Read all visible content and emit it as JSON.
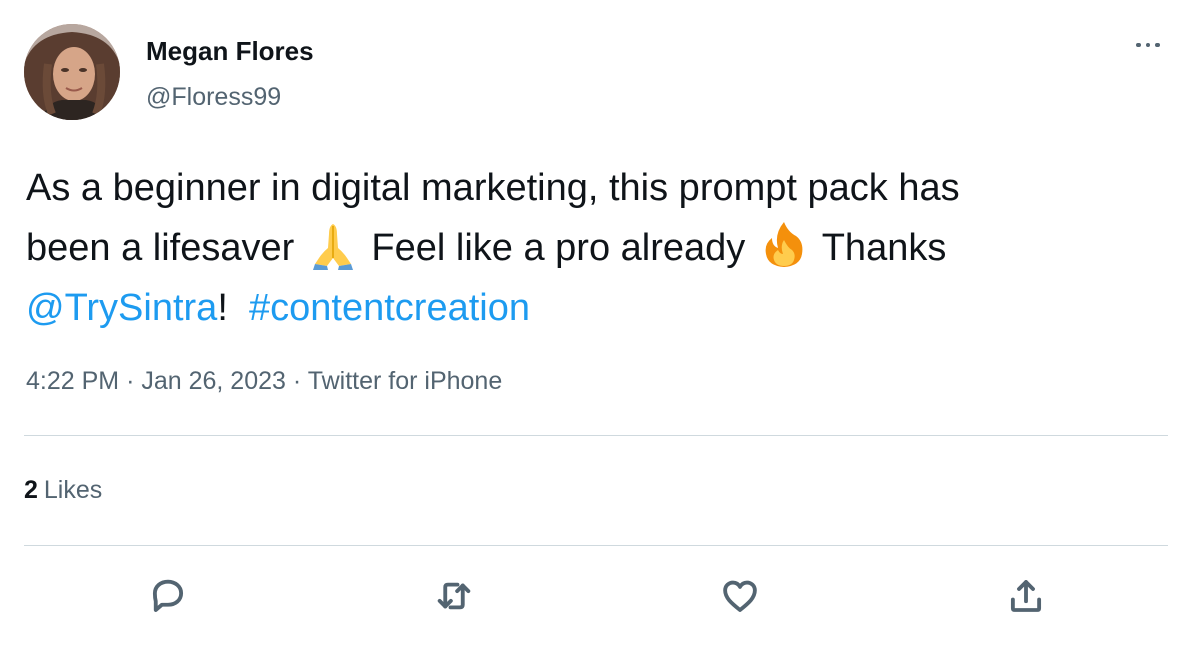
{
  "author": {
    "name": "Megan Flores",
    "handle": "@Floress99"
  },
  "tweet": {
    "text_line1": "As a beginner in digital marketing, this prompt pack has",
    "text_line2_a": "been a lifesaver",
    "emoji_1": "folded-hands-emoji",
    "text_line2_b": "Feel like a pro already",
    "emoji_2": "fire-emoji",
    "text_line2_c": "Thanks",
    "mention": "@TrySintra",
    "after_mention": "!",
    "hashtag": "#contentcreation"
  },
  "meta": {
    "time": "4:22 PM",
    "separator": "·",
    "date": "Jan 26, 2023",
    "source": "Twitter for iPhone"
  },
  "stats": {
    "likes_count": "2",
    "likes_label": "Likes"
  },
  "actions": {
    "reply_icon": "reply-icon",
    "retweet_icon": "retweet-icon",
    "like_icon": "heart-icon",
    "share_icon": "share-icon",
    "more_icon": "more-icon"
  },
  "colors": {
    "link": "#1d9bf0",
    "secondary_text": "#536471",
    "primary_text": "#0f1419",
    "divider": "#cfd9de"
  }
}
